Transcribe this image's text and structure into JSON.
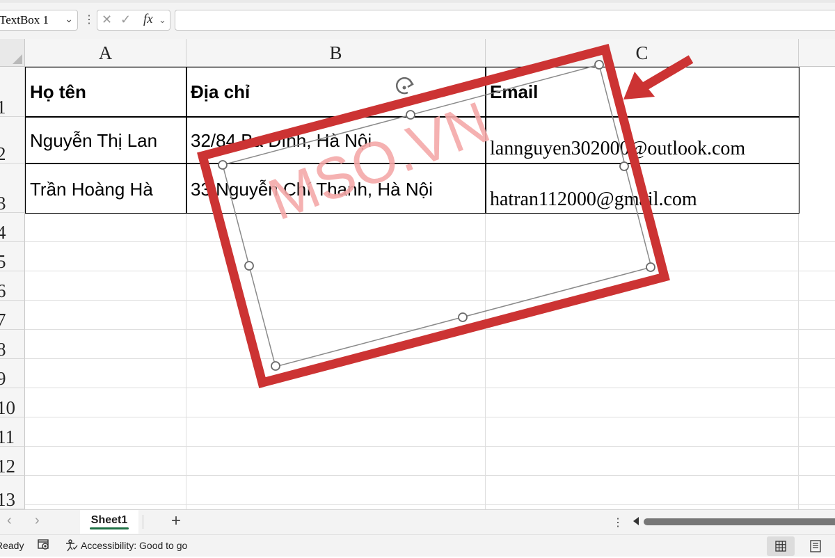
{
  "formula_bar": {
    "name_box": "TextBox 1",
    "cancel_icon": "x-icon",
    "enter_icon": "check-icon",
    "fx_label": "fx",
    "formula_value": ""
  },
  "columns": [
    "A",
    "B",
    "C"
  ],
  "rows": [
    "1",
    "2",
    "3",
    "4",
    "5",
    "6",
    "7",
    "8",
    "9",
    "10",
    "11",
    "12",
    "13"
  ],
  "table": {
    "headers": [
      "Họ tên",
      "Địa chỉ",
      "Email"
    ],
    "rows": [
      [
        "Nguyễn Thị Lan",
        "32/84 Ba Đình, Hà Nội",
        "lannguyen302000@outlook.com"
      ],
      [
        "Trần Hoàng Hà",
        "33 Nguyễn Chí Thanh, Hà Nội",
        "hatran112000@gmail.com"
      ]
    ]
  },
  "textbox": {
    "watermark": "MSO.VN",
    "watermark_color": "#f4a8a8",
    "highlight_color": "#cc3333"
  },
  "sheet_tabs": {
    "active": "Sheet1",
    "add_label": "+"
  },
  "status_bar": {
    "ready": "Ready",
    "accessibility": "Accessibility: Good to go"
  }
}
